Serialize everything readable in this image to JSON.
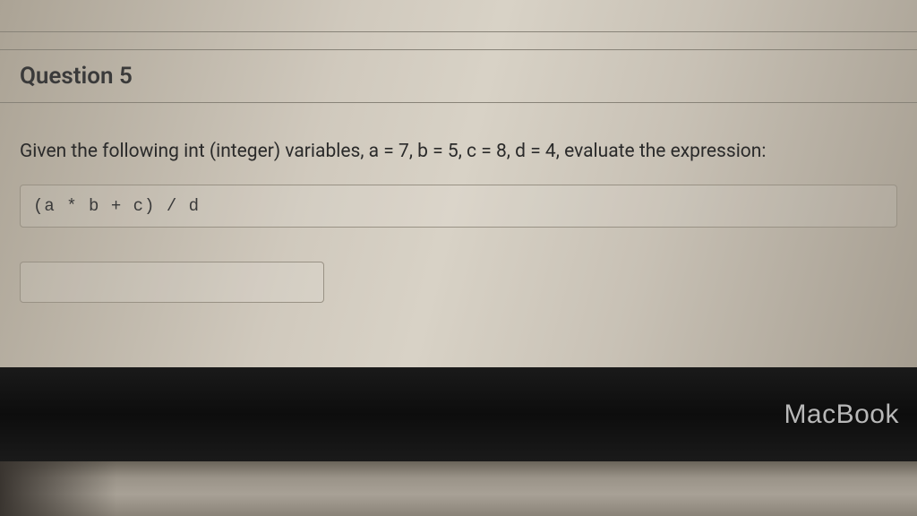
{
  "question": {
    "title": "Question 5",
    "prompt": "Given the following int (integer) variables, a = 7, b = 5, c = 8, d = 4, evaluate the expression:",
    "expression": "(a * b + c) / d",
    "answer_value": ""
  },
  "device": {
    "brand": "MacBook"
  }
}
